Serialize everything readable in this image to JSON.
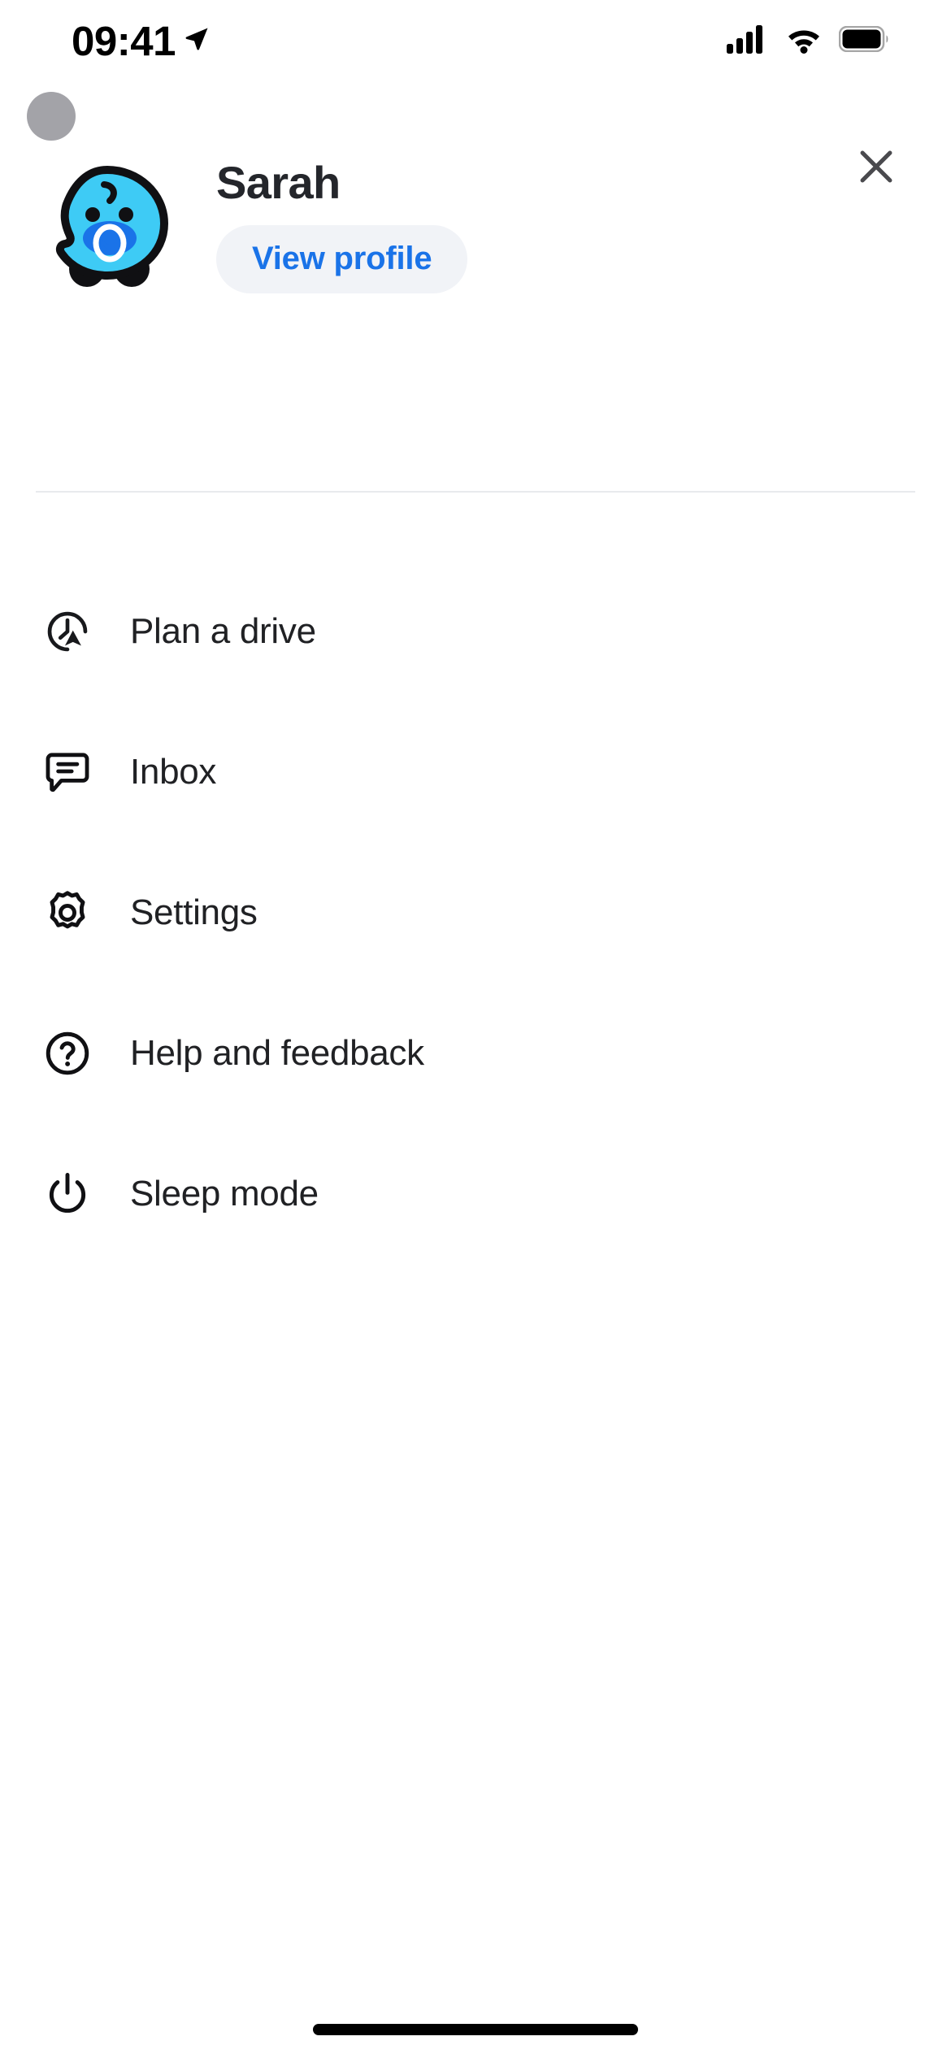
{
  "status_bar": {
    "time": "09:41",
    "location_icon": "location-arrow-icon",
    "cellular_icon": "cellular-signal-icon",
    "wifi_icon": "wifi-icon",
    "battery_icon": "battery-full-icon"
  },
  "header": {
    "close_icon": "close-icon",
    "avatar_placeholder": "avatar-placeholder-dot"
  },
  "profile": {
    "name": "Sarah",
    "view_profile_label": "View profile",
    "mood_icon": "waze-baby-mood-icon",
    "mood_colors": {
      "body": "#3ecbf5",
      "outline": "#101013",
      "pacifier": "#1a73e8",
      "pacifier_ring": "#ffffff"
    }
  },
  "menu": {
    "items": [
      {
        "label": "Plan a drive",
        "icon": "plan-a-drive-icon"
      },
      {
        "label": "Inbox",
        "icon": "inbox-icon"
      },
      {
        "label": "Settings",
        "icon": "gear-icon"
      },
      {
        "label": "Help and feedback",
        "icon": "question-circle-icon"
      },
      {
        "label": "Sleep mode",
        "icon": "power-icon"
      }
    ]
  },
  "colors": {
    "accent_blue": "#1a73e8",
    "pill_background": "#f1f3f7",
    "text_primary": "#202124",
    "divider": "#e8eaed",
    "close_icon": "#4a4a4e",
    "placeholder_dot": "#a3a3a8"
  },
  "system": {
    "home_indicator": "home-indicator"
  }
}
